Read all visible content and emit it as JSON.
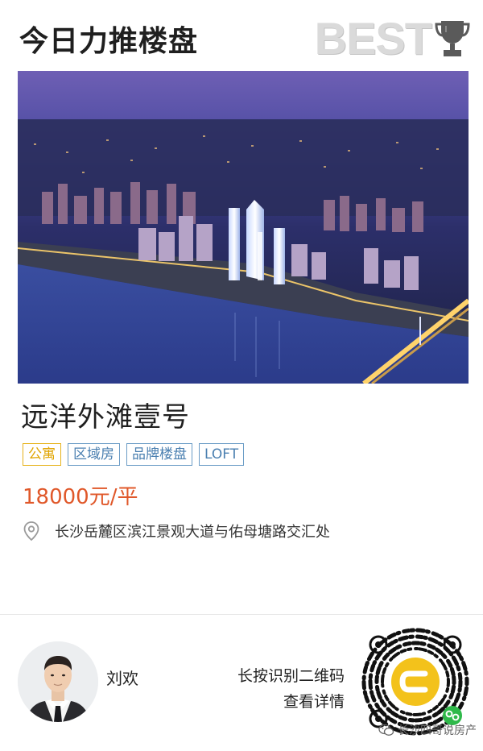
{
  "header": {
    "title": "今日力推楼盘",
    "badge_text": "BEST",
    "trophy_icon": "trophy-icon"
  },
  "listing": {
    "name": "远洋外滩壹号",
    "tags": [
      {
        "label": "公寓",
        "color": "#e6b21a"
      },
      {
        "label": "区域房",
        "color": "#6b9cc6"
      },
      {
        "label": "品牌楼盘",
        "color": "#6b9cc6"
      },
      {
        "label": "LOFT",
        "color": "#6b9cc6"
      }
    ],
    "price": "18000元/平",
    "address": "长沙岳麓区滨江景观大道与佑母塘路交汇处",
    "address_icon": "location-pin-icon"
  },
  "agent": {
    "name": "刘欢",
    "cta_line1": "长按识别二维码",
    "cta_line2": "查看详情"
  },
  "watermark": {
    "text": "长沙四哥说房产",
    "icon": "wechat-icon"
  },
  "colors": {
    "price": "#e0582a",
    "tag_yellow": "#e6b21a",
    "tag_blue": "#6b9cc6"
  }
}
